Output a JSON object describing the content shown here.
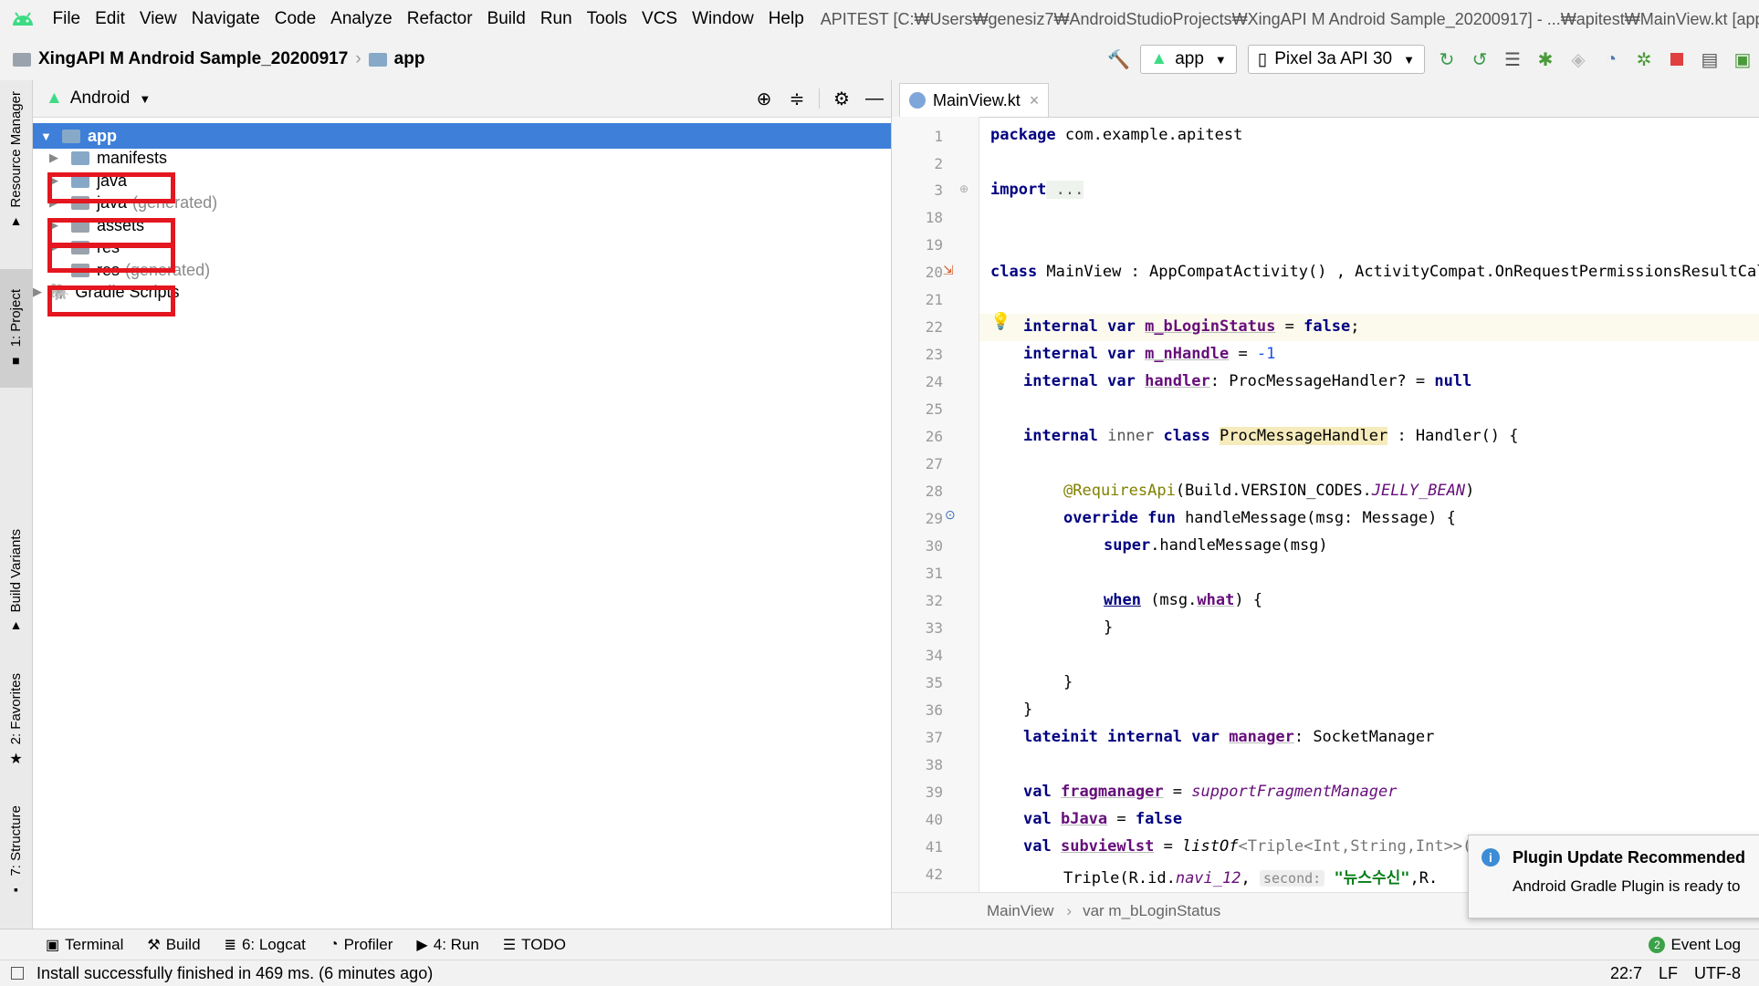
{
  "menu": {
    "items": [
      "File",
      "Edit",
      "View",
      "Navigate",
      "Code",
      "Analyze",
      "Refactor",
      "Build",
      "Run",
      "Tools",
      "VCS",
      "Window",
      "Help"
    ],
    "window_title": "APITEST [C:₩Users₩genesiz7₩AndroidStudioProjects₩XingAPI M Android Sample_20200917] - ...₩apitest₩MainView.kt [app]"
  },
  "breadcrumb": {
    "project": "XingAPI M Android Sample_20200917",
    "module": "app"
  },
  "toolbar": {
    "run_config": "app",
    "device": "Pixel 3a API 30"
  },
  "side_tabs": {
    "resource_manager": "Resource Manager",
    "project": "1: Project",
    "build_variants": "Build Variants",
    "favorites": "2: Favorites",
    "structure": "7: Structure"
  },
  "project_panel": {
    "view_mode": "Android",
    "tree": [
      {
        "label": "app",
        "suffix": ""
      },
      {
        "label": "manifests",
        "suffix": ""
      },
      {
        "label": "java",
        "suffix": ""
      },
      {
        "label": "java",
        "suffix": "(generated)"
      },
      {
        "label": "assets",
        "suffix": ""
      },
      {
        "label": "res",
        "suffix": ""
      },
      {
        "label": "res",
        "suffix": "(generated)"
      },
      {
        "label": "Gradle Scripts",
        "suffix": ""
      }
    ]
  },
  "editor": {
    "tab": "MainView.kt",
    "line_numbers": [
      "1",
      "2",
      "3",
      "18",
      "19",
      "20",
      "21",
      "22",
      "23",
      "24",
      "25",
      "26",
      "27",
      "28",
      "29",
      "30",
      "31",
      "32",
      "33",
      "34",
      "35",
      "36",
      "37",
      "38",
      "39",
      "40",
      "41",
      "42"
    ],
    "code": {
      "l1a": "package",
      "l1b": " com.example.apitest",
      "l3a": "import",
      "l3b": " ...",
      "l20a": "class",
      "l20b": " MainView : AppCompatActivity() , ActivityCompat.OnRequestPermissionsResultCallback",
      "l22a": "internal var",
      "l22b": "m_bLoginStatus",
      "l22c": " = ",
      "l22d": "false",
      "l22e": ";",
      "l23a": "internal var",
      "l23b": "m_nHandle",
      "l23c": " = ",
      "l23d": "-1",
      "l24a": "internal var",
      "l24b": "handler",
      "l24c": ": ProcMessageHandler? = ",
      "l24d": "null",
      "l26a": "internal",
      "l26b": " inner ",
      "l26c": "class",
      "l26d": "ProcMessageHandler",
      "l26e": " : Handler() {",
      "l28a": "@RequiresApi",
      "l28b": "(Build.VERSION_CODES.",
      "l28c": "JELLY_BEAN",
      "l28d": ")",
      "l29a": "override fun",
      "l29b": " handleMessage(msg: Message) {",
      "l30a": "super",
      "l30b": ".handleMessage(msg)",
      "l32a": "when",
      "l32b": " (msg.",
      "l32c": "what",
      "l32d": ") {",
      "l33": "}",
      "l35": "}",
      "l36": "}",
      "l37a": "lateinit internal var",
      "l37b": "manager",
      "l37c": ": SocketManager",
      "l39a": "val",
      "l39b": "fragmanager",
      "l39c": " = ",
      "l39d": "supportFragmentManager",
      "l40a": "val",
      "l40b": "bJava",
      "l40c": " = ",
      "l40d": "false",
      "l41a": "val",
      "l41b": "subviewlst",
      "l41c": " = ",
      "l41d": "listOf",
      "l41e": "<Triple<Int,String,Int>>(",
      "l42a": "Triple(R.id.",
      "l42b": "navi_12",
      "l42c": ", ",
      "l42d": "second:",
      "l42e": "\"뉴스수신\"",
      "l42f": ",R."
    },
    "crumb_class": "MainView",
    "crumb_member": "var m_bLoginStatus"
  },
  "notification": {
    "title": "Plugin Update Recommended",
    "body": "Android Gradle Plugin is ready to"
  },
  "bottom_tools": [
    {
      "label": "Terminal",
      "icon": "terminal-icon"
    },
    {
      "label": "Build",
      "icon": "hammer-icon"
    },
    {
      "label": "6: Logcat",
      "icon": "logcat-icon"
    },
    {
      "label": "Profiler",
      "icon": "profiler-icon"
    },
    {
      "label": "4: Run",
      "icon": "run-icon"
    },
    {
      "label": "TODO",
      "icon": "list-icon"
    }
  ],
  "event_log": {
    "label": "Event Log",
    "count": "2"
  },
  "status": {
    "message": "Install successfully finished in 469 ms. (6 minutes ago)",
    "position": "22:7",
    "line_sep": "LF",
    "encoding": "UTF-8"
  },
  "colors": {
    "selection": "#3d7fd9",
    "highlight_box": "#e4161f",
    "android_green": "#3ddc84"
  }
}
